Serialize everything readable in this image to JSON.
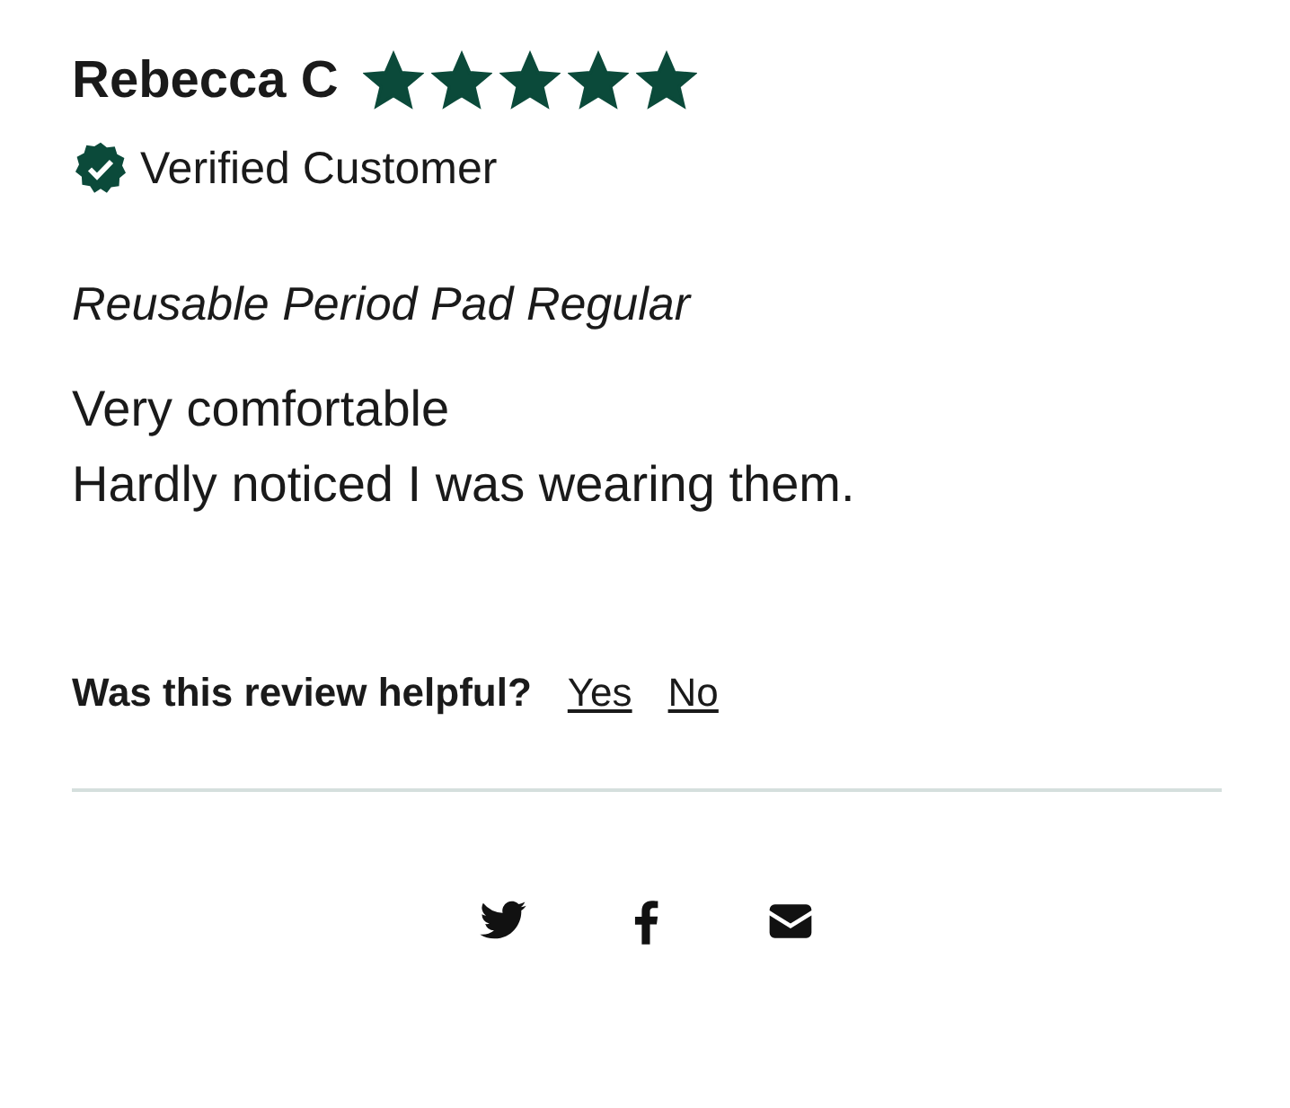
{
  "review": {
    "author": "Rebecca C",
    "stars": 5,
    "verified": {
      "label": "Verified Customer"
    },
    "product": "Reusable Period Pad Regular",
    "title": "Very comfortable",
    "body": "Hardly noticed I was wearing them."
  },
  "helpful": {
    "question": "Was this review helpful?",
    "options": [
      "Yes",
      "No"
    ]
  }
}
